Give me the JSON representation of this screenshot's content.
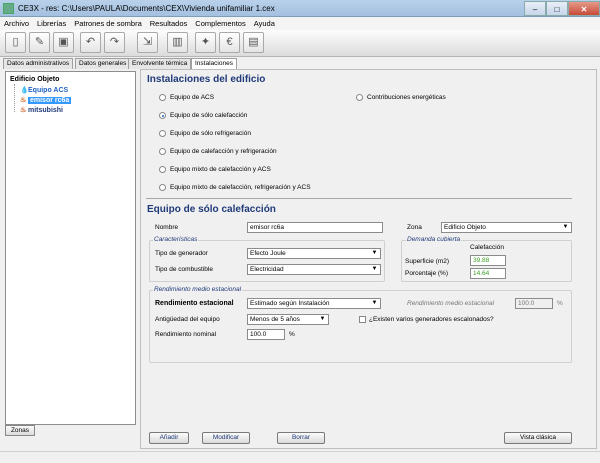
{
  "window": {
    "title": "CE3X - res: C:\\Users\\PAULA\\Documents\\CEX\\Vivienda unifamiliar 1.cex",
    "close": "✕",
    "maximize": "□",
    "minimize": "–"
  },
  "menu": [
    "Archivo",
    "Librerías",
    "Patrones de sombra",
    "Resultados",
    "Complementos",
    "Ayuda"
  ],
  "toolbar": [
    "new-doc",
    "edit",
    "save",
    "undo",
    "redo",
    "import",
    "building",
    "wand",
    "euro",
    "report"
  ],
  "tabs": [
    "Datos administrativos",
    "Datos generales",
    "Envolvente térmica",
    "Instalaciones"
  ],
  "tree": {
    "root": "Edificio Objeto",
    "items": [
      {
        "label": "Equipo ACS",
        "color": "#1f62c5"
      },
      {
        "label": "emisor rc6a",
        "selected": true
      },
      {
        "label": "mitsubishi",
        "color": "#1f3a78"
      }
    ]
  },
  "zonas_btn": "Zonas",
  "section": {
    "title": "Instalaciones del edificio",
    "options_left": [
      "Equipo de ACS",
      "Equipo de sólo calefacción",
      "Equipo de sólo refrigeración",
      "Equipo de calefacción y refrigeración",
      "Equipo mixto de calefacción y ACS",
      "Equipo mixto de calefacción, refrigeración y ACS"
    ],
    "option_right": "Contribuciones energéticas",
    "selected_index": 1
  },
  "form": {
    "title": "Equipo de sólo calefacción",
    "nombre_label": "Nombre",
    "nombre_value": "emisor rc6a",
    "zona_label": "Zona",
    "zona_value": "Edificio Objeto",
    "caracteristicas": "Características",
    "tipo_generador_label": "Tipo de generador",
    "tipo_generador_value": "Efecto Joule",
    "tipo_combustible_label": "Tipo de combustible",
    "tipo_combustible_value": "Electricidad",
    "demanda": "Demanda cubierta",
    "calefaccion": "Calefacción",
    "superficie_label": "Superficie (m2)",
    "superficie_value": "39.88",
    "porcentaje_label": "Porcentaje (%)",
    "porcentaje_value": "14.64",
    "rendimiento_group": "Rendimiento medio estacional",
    "rend_estacional_label": "Rendimiento estacional",
    "rend_estacional_value": "Estimado según Instalación",
    "rend_medio_label": "Rendimiento medio estacional",
    "rend_medio_value": "100.0",
    "percent": "%",
    "antiguedad_label": "Antigüedad del equipo",
    "antiguedad_value": "Menos de 5 años",
    "escalonados_label": "¿Existen varios generadores escalonados?",
    "rend_nominal_label": "Rendimiento nominal",
    "rend_nominal_value": "100.0"
  },
  "buttons": {
    "add": "Añadir",
    "modify": "Modificar",
    "delete": "Borrar",
    "classic": "Vista clásica"
  }
}
